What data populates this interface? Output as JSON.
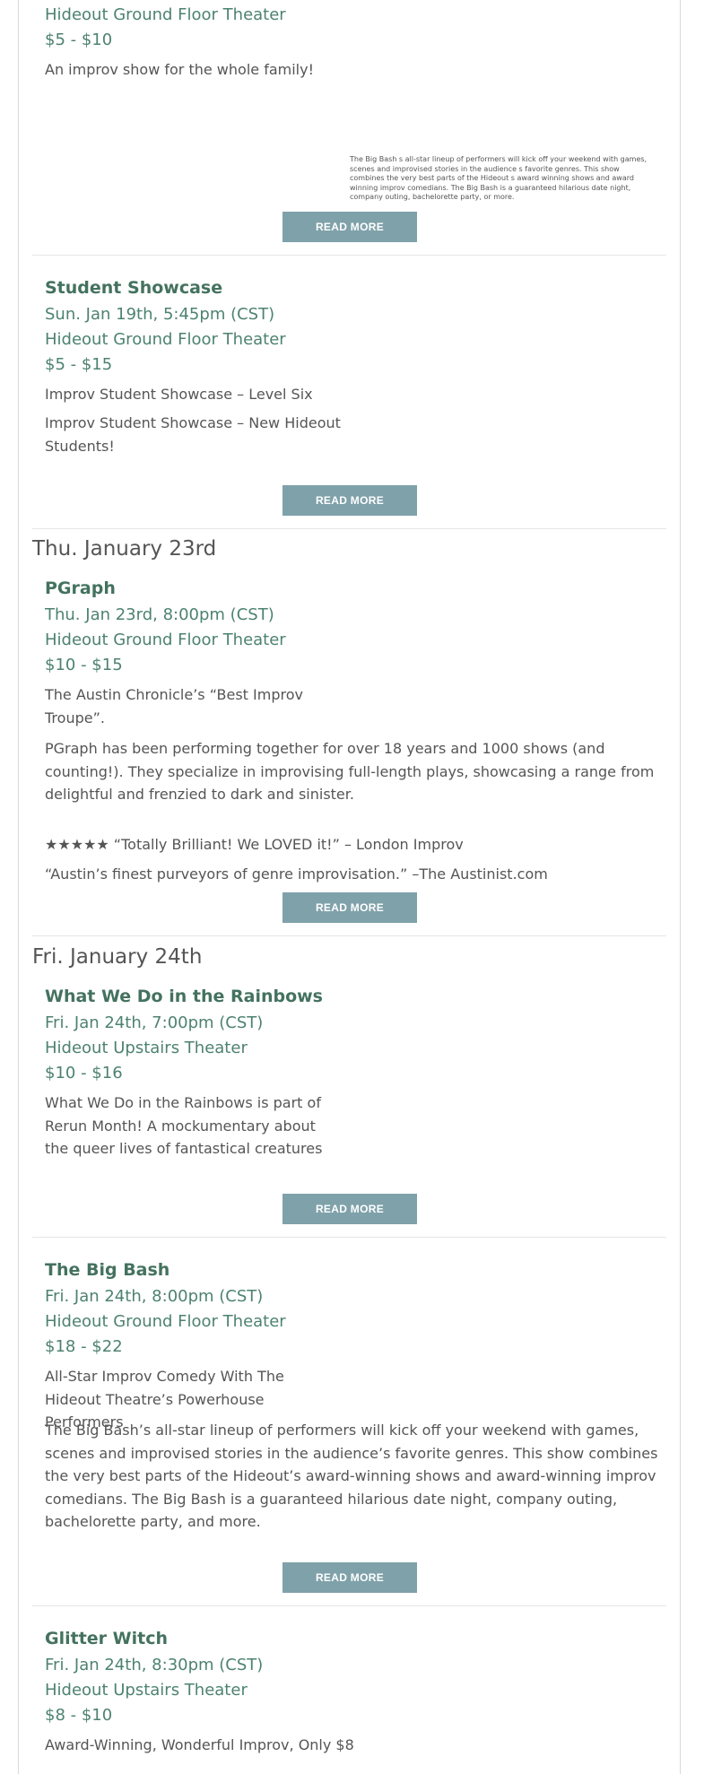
{
  "events": [
    {
      "title": "",
      "date": "",
      "venue": "Hideout Ground Floor Theater",
      "price": "$5 - $10",
      "desc": [
        "An improv show for the whole family!"
      ],
      "side_text": "The Big Bash  s all-star lineup of performers will kick off your weekend with games, scenes and improvised stories in the audience  s favorite genres. This show combines the very best parts of the Hideout  s award winning shows and award winning improv comedians. The Big Bash is a guaranteed hilarious date night, company outing, bachelorette party, or more.",
      "button": "READ MORE"
    },
    {
      "title": "Student Showcase",
      "date": "Sun. Jan 19th, 5:45pm (CST)",
      "venue": "Hideout Ground Floor Theater",
      "price": "$5 - $15",
      "desc": [
        "Improv Student Showcase – Level Six",
        "Improv Student Showcase – New Hideout Students!"
      ],
      "button": "READ MORE"
    },
    {
      "title": "PGraph",
      "date": "Thu. Jan 23rd, 8:00pm (CST)",
      "venue": "Hideout Ground Floor Theater",
      "price": "$10 - $15",
      "desc": [
        "The Austin Chronicle’s “Best Improv Troupe”.",
        "PGraph has been performing together for over 18 years and 1000 shows (and counting!). They specialize in improvising full-length plays, showcasing a range from delightful and frenzied to dark and sinister.",
        "★★★★★ “Totally Brilliant! We LOVED it!” – London Improv",
        "“Austin’s finest purveyors of genre improvisation.” –The Austinist.com"
      ],
      "button": "READ MORE"
    },
    {
      "title": "What We Do in the Rainbows",
      "date": "Fri. Jan 24th, 7:00pm (CST)",
      "venue": "Hideout Upstairs Theater",
      "price": "$10 - $16",
      "desc": [
        "What We Do in the Rainbows is part of Rerun Month! A mockumentary about the queer lives of fantastical creatures"
      ],
      "button": "READ MORE"
    },
    {
      "title": "The Big Bash",
      "date": "Fri. Jan 24th, 8:00pm (CST)",
      "venue": "Hideout Ground Floor Theater",
      "price": "$18 - $22",
      "desc": [
        "All-Star Improv Comedy With The Hideout Theatre’s Powerhouse Performers",
        "The Big Bash’s all-star lineup of performers will kick off your weekend with games, scenes and improvised stories in the audience’s favorite genres. This show combines the very best parts of the Hideout’s award-winning shows and award-winning improv comedians. The Big Bash is a guaranteed hilarious date night, company outing, bachelorette party, and more."
      ],
      "button": "READ MORE"
    },
    {
      "title": "Glitter Witch",
      "date": "Fri. Jan 24th, 8:30pm (CST)",
      "venue": "Hideout Upstairs Theater",
      "price": "$8 - $10",
      "desc": [
        "Award-Winning, Wonderful Improv, Only $8"
      ]
    }
  ],
  "days": [
    {
      "label": "Thu. January 23rd"
    },
    {
      "label": "Fri. January 24th"
    }
  ]
}
